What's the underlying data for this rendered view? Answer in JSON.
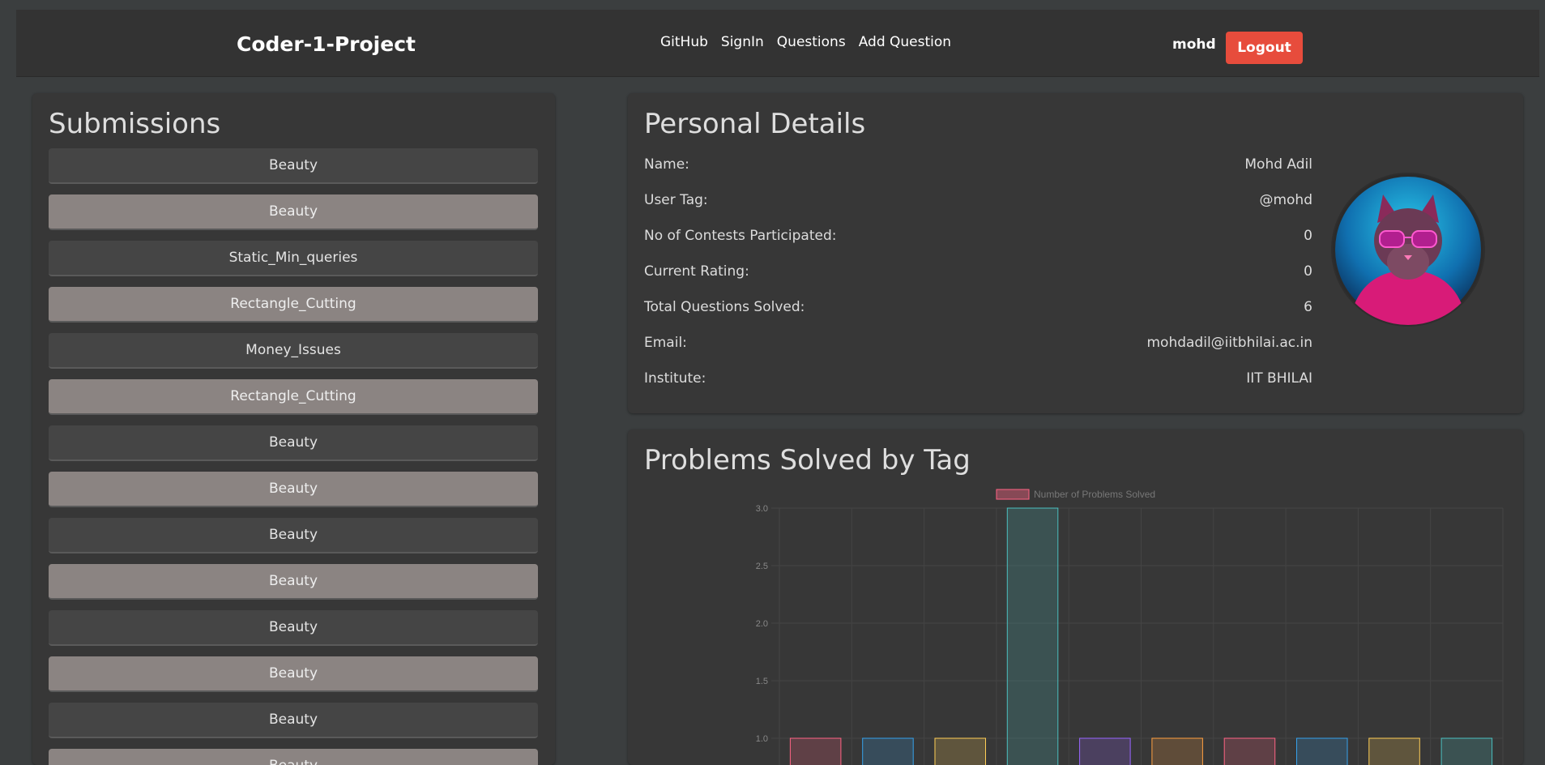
{
  "nav": {
    "brand": "Coder-1-Project",
    "links": [
      "GitHub",
      "SignIn",
      "Questions",
      "Add Question"
    ],
    "username": "mohd",
    "logout": "Logout"
  },
  "submissions": {
    "title": "Submissions",
    "items": [
      {
        "label": "Beauty",
        "style": "dark"
      },
      {
        "label": "Beauty",
        "style": "light"
      },
      {
        "label": "Static_Min_queries",
        "style": "dark"
      },
      {
        "label": "Rectangle_Cutting",
        "style": "light"
      },
      {
        "label": "Money_Issues",
        "style": "dark"
      },
      {
        "label": "Rectangle_Cutting",
        "style": "light"
      },
      {
        "label": "Beauty",
        "style": "dark"
      },
      {
        "label": "Beauty",
        "style": "light"
      },
      {
        "label": "Beauty",
        "style": "dark"
      },
      {
        "label": "Beauty",
        "style": "light"
      },
      {
        "label": "Beauty",
        "style": "dark"
      },
      {
        "label": "Beauty",
        "style": "light"
      },
      {
        "label": "Beauty",
        "style": "dark"
      },
      {
        "label": "Beauty",
        "style": "light"
      }
    ]
  },
  "details": {
    "title": "Personal Details",
    "rows": [
      {
        "label": "Name:",
        "value": "Mohd Adil"
      },
      {
        "label": "User Tag:",
        "value": "@mohd"
      },
      {
        "label": "No of Contests Participated:",
        "value": "0"
      },
      {
        "label": "Current Rating:",
        "value": "0"
      },
      {
        "label": "Total Questions Solved:",
        "value": "6"
      },
      {
        "label": "Email:",
        "value": "mohdadil@iitbhilai.ac.in"
      },
      {
        "label": "Institute:",
        "value": "IIT BHILAI"
      }
    ],
    "avatar_icon": "cat-with-sunglasses-avatar"
  },
  "chart_card": {
    "title": "Problems Solved by Tag"
  },
  "chart_data": {
    "type": "bar",
    "title": "",
    "legend": "Number of Problems Solved",
    "legend_position": "top",
    "values": [
      1,
      1,
      1,
      3,
      1,
      1,
      1,
      1,
      1,
      1
    ],
    "y_ticks": [
      "3.0",
      "2.5",
      "2.0",
      "1.5",
      "1.0"
    ],
    "ylim_visible": [
      0.8,
      3.0
    ],
    "grid": true,
    "bar_colors": [
      "#ff6384",
      "#36a2eb",
      "#ffce56",
      "#4bc0c0",
      "#9966ff",
      "#ff9f40",
      "#ff6384",
      "#36a2eb",
      "#ffce56",
      "#4bc0c0"
    ]
  }
}
